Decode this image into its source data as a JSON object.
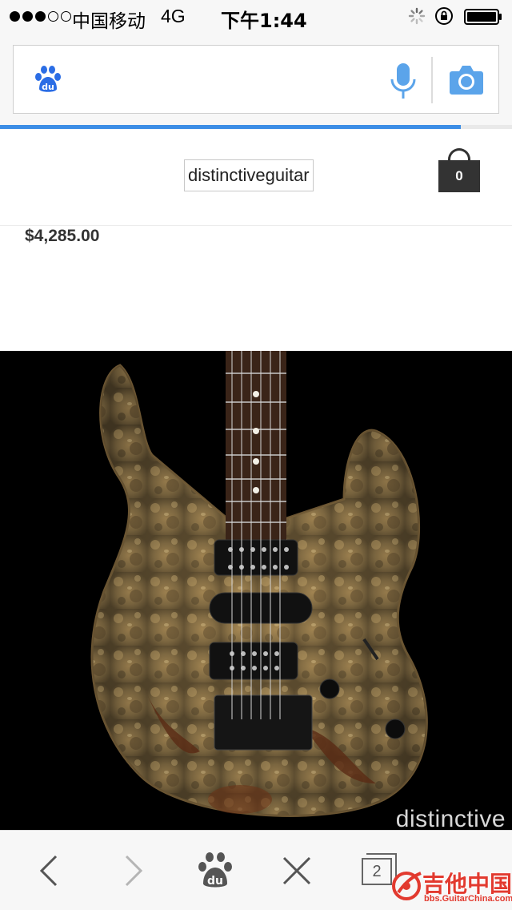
{
  "status_bar": {
    "carrier": "中国移动",
    "network": "4G",
    "time": "下午1:44",
    "signal_bars_filled": 3,
    "signal_bars_total": 5
  },
  "browser": {
    "search_placeholder": "",
    "logo_icon": "baidu-paw-icon",
    "voice_icon": "microphone-icon",
    "camera_icon": "camera-icon",
    "load_progress_percent": 90,
    "accent_color": "#3d8ee6"
  },
  "site": {
    "logo_text": "distinctiveguitar",
    "cart_count": "0",
    "price": "$4,285.00",
    "image_watermark": "distinctive"
  },
  "toolbar": {
    "back_icon": "chevron-left-icon",
    "forward_icon": "chevron-right-icon",
    "home_icon": "baidu-paw-icon",
    "close_icon": "close-icon",
    "tab_count": "2"
  },
  "overlay_watermark": {
    "name": "吉他中国",
    "url": "bbs.GuitarChina.com"
  }
}
